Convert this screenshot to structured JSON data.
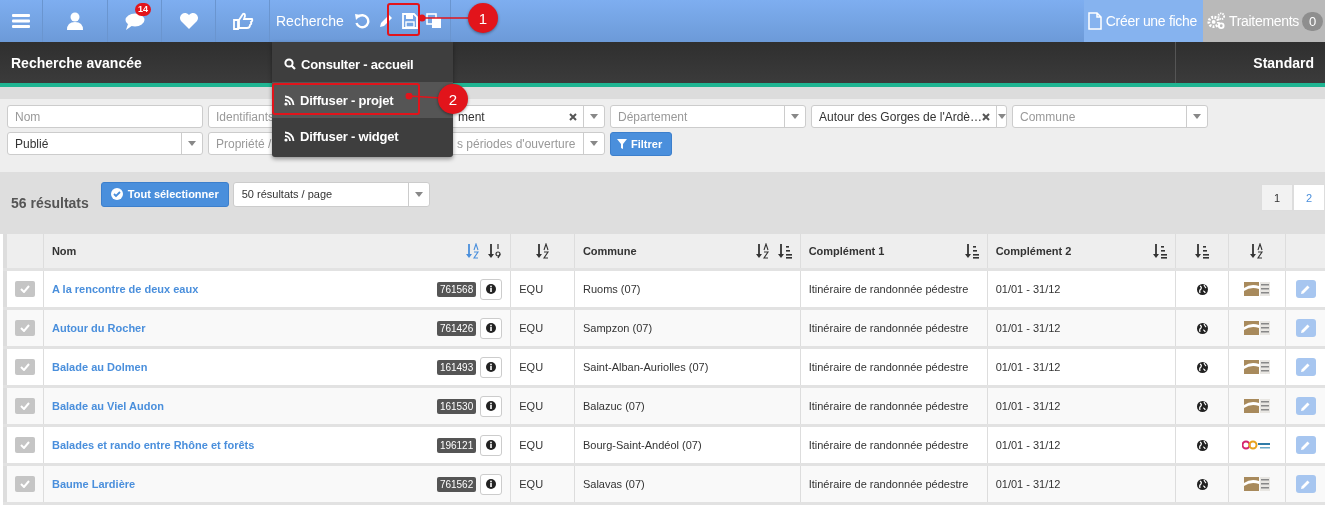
{
  "topbar": {
    "icons": [
      {
        "kind": "menu"
      },
      {
        "kind": "user"
      },
      {
        "kind": "chat",
        "badge": "14"
      },
      {
        "kind": "heart"
      },
      {
        "kind": "thumb"
      }
    ],
    "search_label": "Recherche",
    "tools": [
      {
        "kind": "undo"
      },
      {
        "kind": "pencil"
      },
      {
        "kind": "save"
      },
      {
        "kind": "copy"
      }
    ],
    "create_label": "Créer une fiche",
    "processing_label": "Traitements",
    "processing_count": "0"
  },
  "header": {
    "title": "Recherche avancée",
    "mode": "Standard"
  },
  "menu": [
    {
      "kind": "search",
      "label": "Consulter - accueil",
      "selected": false
    },
    {
      "kind": "rss",
      "label": "Diffuser - projet",
      "selected": true
    },
    {
      "kind": "rss",
      "label": "Diffuser - widget",
      "selected": false
    }
  ],
  "filters": [
    {
      "kind": "text",
      "placeholder": "Nom"
    },
    {
      "kind": "text",
      "placeholder": "Identifiants"
    },
    {
      "kind": "clear",
      "value": "ment"
    },
    {
      "kind": "select",
      "placeholder": "Département"
    },
    {
      "kind": "clear",
      "value": "Autour des Gorges de l'Ardè…"
    },
    {
      "kind": "select",
      "placeholder": "Commune"
    },
    {
      "kind": "select",
      "value": "Publié"
    },
    {
      "kind": "select",
      "placeholder": "Propriété /"
    },
    {
      "kind": "select",
      "placeholder": "s périodes d'ouverture"
    },
    {
      "kind": "button",
      "label": "Filtrer"
    }
  ],
  "results": {
    "count": "56 résultats",
    "select_all": "Tout sélectionner",
    "per_page": "50 résultats / page",
    "pages": [
      {
        "label": "1",
        "selected": true
      },
      {
        "label": "2",
        "selected": false
      }
    ]
  },
  "table": {
    "columns": [
      {
        "label": "Nom",
        "sorts": [
          {
            "kind": "az",
            "active": true
          },
          {
            "kind": "num",
            "active": false
          }
        ]
      },
      {
        "sorts": [
          {
            "kind": "az",
            "active": false
          }
        ]
      },
      {
        "label": "Commune",
        "sorts": [
          {
            "kind": "az",
            "active": false
          },
          {
            "kind": "list",
            "active": false
          }
        ]
      },
      {
        "label": "Complément 1",
        "sorts": [
          {
            "kind": "list",
            "active": false
          }
        ]
      },
      {
        "label": "Complément 2",
        "sorts": [
          {
            "kind": "list",
            "active": false
          }
        ]
      },
      {
        "sorts": [
          {
            "kind": "list",
            "active": false
          }
        ]
      },
      {
        "sorts": [
          {
            "kind": "az",
            "active": false
          }
        ]
      }
    ],
    "rows": [
      {
        "name": "A la rencontre de deux eaux",
        "id": "761568",
        "type": "EQU",
        "commune": "Ruoms (07)",
        "complement_1": "Itinéraire de randonnée pédestre",
        "complement_2": "01/01 - 31/12",
        "logo": {
          "kind": "pnr"
        },
        "checked": false
      },
      {
        "name": "Autour du Rocher",
        "id": "761426",
        "type": "EQU",
        "commune": "Sampzon (07)",
        "complement_1": "Itinéraire de randonnée pédestre",
        "complement_2": "01/01 - 31/12",
        "logo": {
          "kind": "pnr"
        },
        "checked": false
      },
      {
        "name": "Balade au Dolmen",
        "id": "161493",
        "type": "EQU",
        "commune": "Saint-Alban-Auriolles (07)",
        "complement_1": "Itinéraire de randonnée pédestre",
        "complement_2": "01/01 - 31/12",
        "logo": {
          "kind": "pnr"
        },
        "checked": false
      },
      {
        "name": "Balade au Viel Audon",
        "id": "161530",
        "type": "EQU",
        "commune": "Balazuc (07)",
        "complement_1": "Itinéraire de randonnée pédestre",
        "complement_2": "01/01 - 31/12",
        "logo": {
          "kind": "pnr"
        },
        "checked": false
      },
      {
        "name": "Balades et rando entre Rhône et forêts",
        "id": "196121",
        "type": "EQU",
        "commune": "Bourg-Saint-Andéol (07)",
        "complement_1": "Itinéraire de randonnée pédestre",
        "complement_2": "01/01 - 31/12",
        "logo": {
          "kind": "go"
        },
        "checked": false
      },
      {
        "name": "Baume Lardière",
        "id": "761562",
        "type": "EQU",
        "commune": "Salavas (07)",
        "complement_1": "Itinéraire de randonnée pédestre",
        "complement_2": "01/01 - 31/12",
        "logo": {
          "kind": "pnr"
        },
        "checked": false
      }
    ]
  },
  "callouts": [
    {
      "label": "1"
    },
    {
      "label": "2"
    }
  ]
}
